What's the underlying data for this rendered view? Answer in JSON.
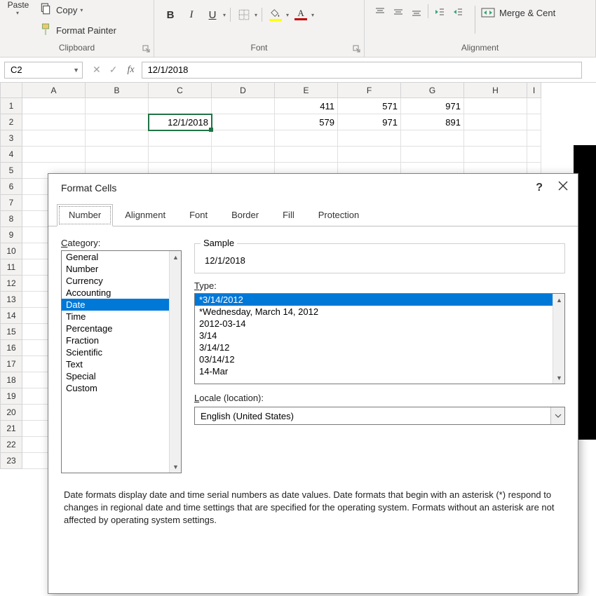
{
  "ribbon": {
    "clipboard": {
      "paste_label": "Paste",
      "copy_label": "Copy",
      "painter_label": "Format Painter",
      "group_label": "Clipboard"
    },
    "font": {
      "bold": "B",
      "italic": "I",
      "underline": "U",
      "group_label": "Font"
    },
    "alignment": {
      "merge_label": "Merge & Cent",
      "group_label": "Alignment"
    }
  },
  "formula_bar": {
    "name_box": "C2",
    "fx_label": "fx",
    "formula": "12/1/2018"
  },
  "grid": {
    "columns": [
      "A",
      "B",
      "C",
      "D",
      "E",
      "F",
      "G",
      "H",
      "I"
    ],
    "rows": [
      "1",
      "2",
      "3",
      "4",
      "5",
      "6",
      "7",
      "8",
      "9",
      "10",
      "11",
      "12",
      "13",
      "14",
      "15",
      "16",
      "17",
      "18",
      "19",
      "20",
      "21",
      "22",
      "23"
    ],
    "cells": {
      "C2": "12/1/2018",
      "E1": "411",
      "F1": "571",
      "G1": "971",
      "E2": "579",
      "F2": "971",
      "G2": "891"
    },
    "selected": "C2"
  },
  "dialog": {
    "title": "Format Cells",
    "tabs": [
      "Number",
      "Alignment",
      "Font",
      "Border",
      "Fill",
      "Protection"
    ],
    "active_tab": "Number",
    "category_label": "Category:",
    "categories": [
      "General",
      "Number",
      "Currency",
      "Accounting",
      "Date",
      "Time",
      "Percentage",
      "Fraction",
      "Scientific",
      "Text",
      "Special",
      "Custom"
    ],
    "selected_category": "Date",
    "sample_label": "Sample",
    "sample_value": "12/1/2018",
    "type_label": "Type:",
    "types": [
      "*3/14/2012",
      "*Wednesday, March 14, 2012",
      "2012-03-14",
      "3/14",
      "3/14/12",
      "03/14/12",
      "14-Mar"
    ],
    "selected_type": "*3/14/2012",
    "locale_label": "Locale (location):",
    "locale_value": "English (United States)",
    "description": "Date formats display date and time serial numbers as date values.  Date formats that begin with an asterisk (*) respond to changes in regional date and time settings that are specified for the operating system. Formats without an asterisk are not affected by operating system settings.",
    "help": "?",
    "close": "✕"
  }
}
